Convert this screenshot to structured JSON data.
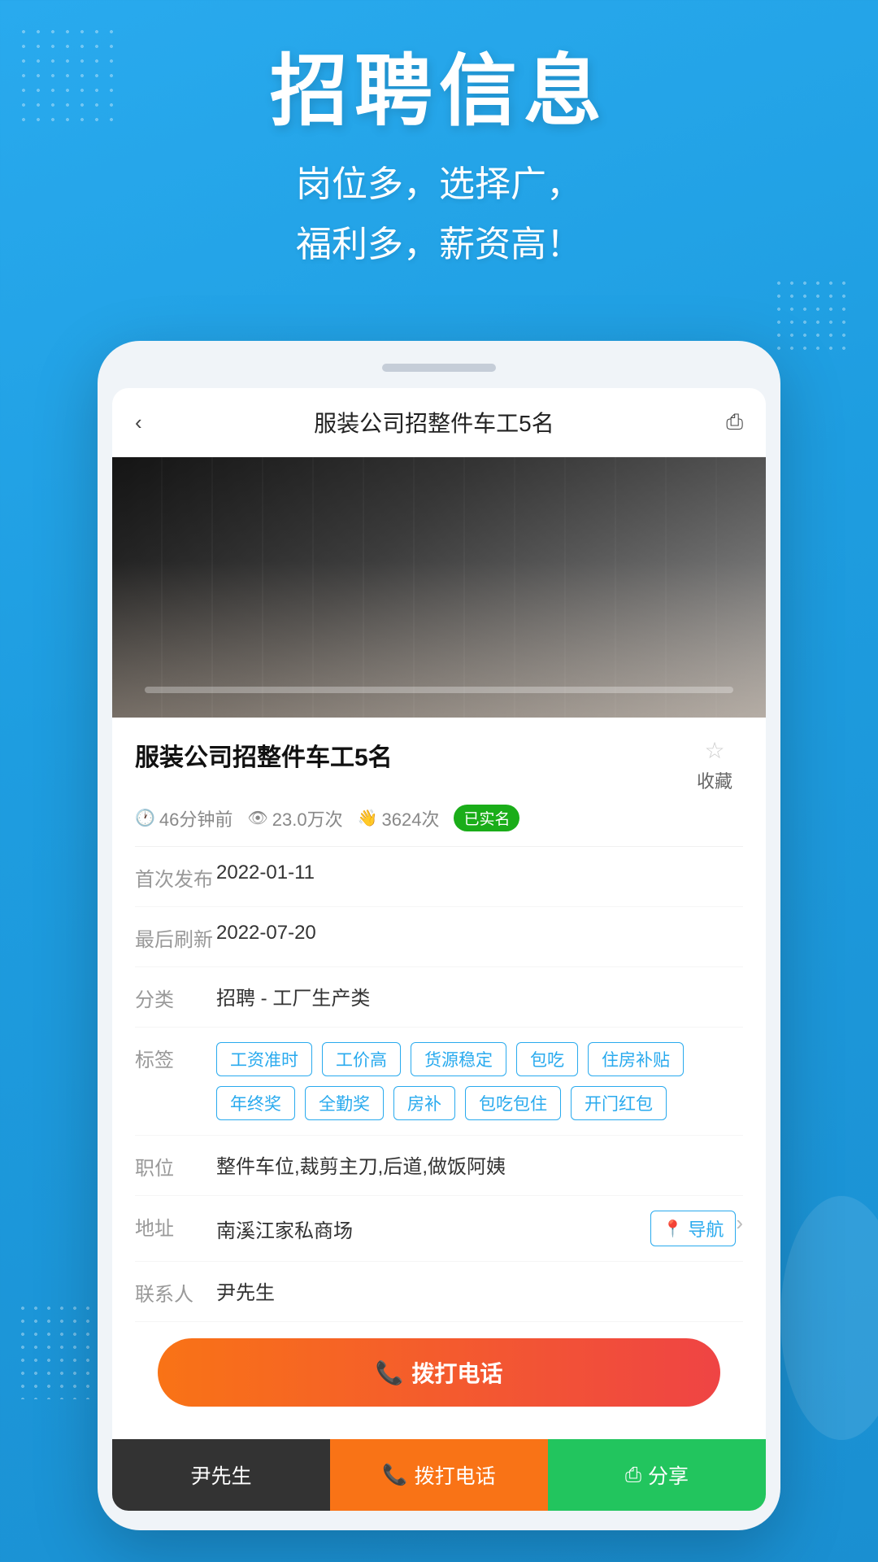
{
  "header": {
    "title": "招聘信息",
    "subtitle_line1": "岗位多，选择广，",
    "subtitle_line2": "福利多，薪资高！"
  },
  "phone": {
    "top_bar": {
      "back_label": "‹",
      "title": "服装公司招整件车工5名",
      "share_label": "⎙"
    },
    "job": {
      "title": "服装公司招整件车工5名",
      "meta": {
        "time_ago": "46分钟前",
        "views": "23.0万次",
        "actions": "3624次",
        "verified": "已实名"
      },
      "collect_label": "收藏",
      "first_publish": "2022-01-11",
      "last_refresh": "2022-07-20",
      "category": "招聘 - 工厂生产类",
      "tags": [
        "工资准时",
        "工价高",
        "货源稳定",
        "包吃",
        "住房补贴",
        "年终奖",
        "全勤奖",
        "房补",
        "包吃包住",
        "开门红包"
      ],
      "position": "整件车位,裁剪主刀,后道,做饭阿姨",
      "address": "南溪江家私商场",
      "nav_label": "导航",
      "contact": "尹先生",
      "call_btn_label": "拨打电话",
      "labels": {
        "first_publish": "首次发布",
        "last_refresh": "最后刷新",
        "category": "分类",
        "tags": "标签",
        "position": "职位",
        "address": "地址",
        "contact": "联系人"
      }
    },
    "bottom_bar": {
      "contact_label": "尹先生",
      "call_label": "拨打电话",
      "share_label": "分享"
    }
  },
  "colors": {
    "blue": "#29aaee",
    "orange": "#f97316",
    "green": "#22c55e",
    "dark": "#333333",
    "verified_green": "#1aad19"
  }
}
